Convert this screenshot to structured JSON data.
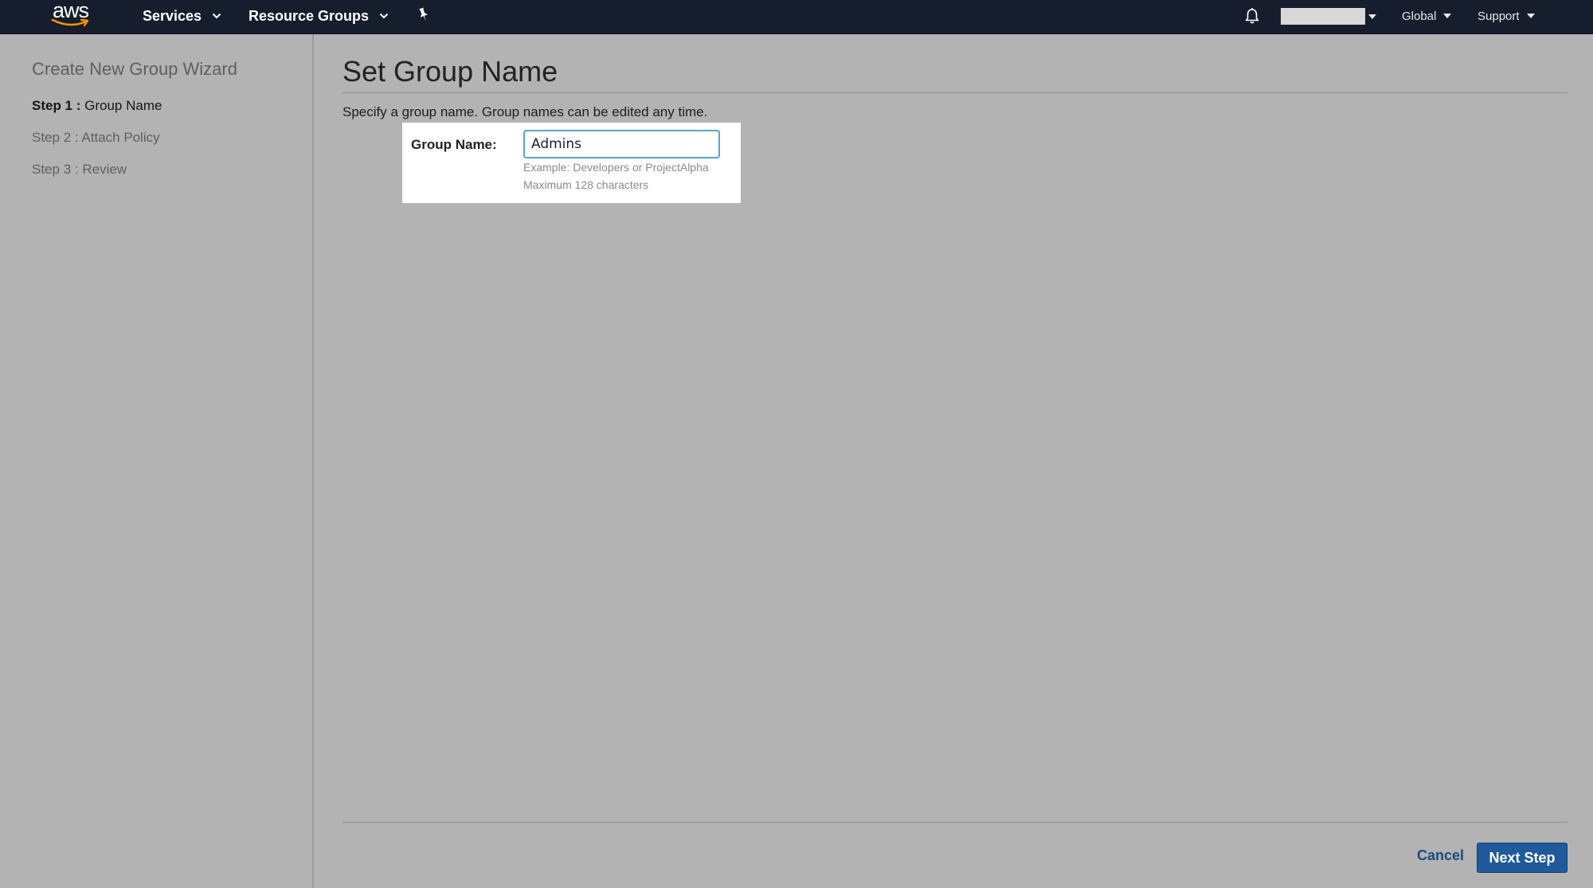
{
  "topbar": {
    "logo_text": "aws",
    "services_label": "Services",
    "resource_groups_label": "Resource Groups",
    "region_label": "Global",
    "support_label": "Support",
    "icons": [
      "pin-icon",
      "bell-icon",
      "chevron-down-icon"
    ]
  },
  "sidebar": {
    "title": "Create New Group Wizard",
    "steps": [
      {
        "number": "Step 1 :",
        "label": "Group Name",
        "active": true
      },
      {
        "number": "Step 2 :",
        "label": "Attach Policy",
        "active": false
      },
      {
        "number": "Step 3 :",
        "label": "Review",
        "active": false
      }
    ]
  },
  "main": {
    "title": "Set Group Name",
    "description": "Specify a group name. Group names can be edited any time.",
    "form": {
      "label": "Group Name:",
      "value": "Admins",
      "hint_example": "Example: Developers or ProjectAlpha",
      "hint_max": "Maximum 128 characters"
    }
  },
  "footer": {
    "cancel_label": "Cancel",
    "next_label": "Next Step"
  },
  "colors": {
    "topbar": "#161e2d",
    "overlay_bg": "#b3b3b3",
    "primary_button": "#1f5a9c",
    "link": "#1a4a80",
    "input_focus": "#5b9fd9",
    "logo_smile": "#f79400"
  }
}
